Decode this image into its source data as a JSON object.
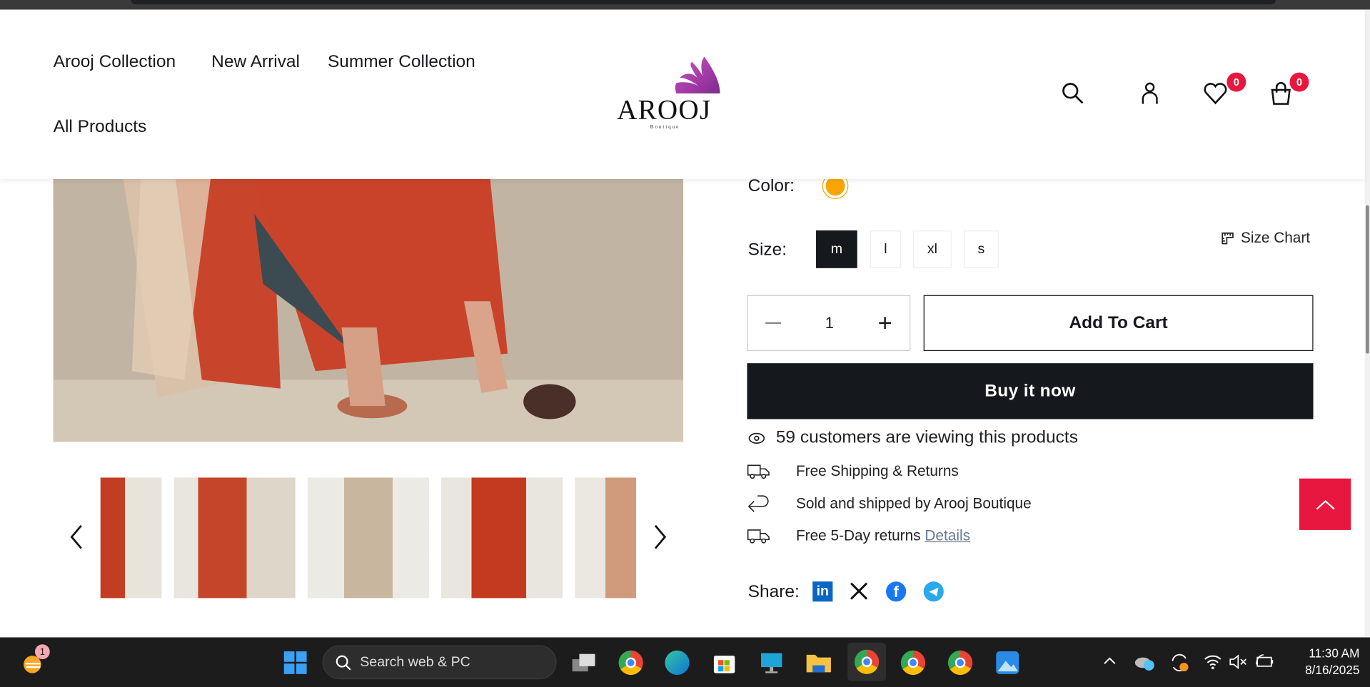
{
  "header": {
    "nav": [
      "Arooj Collection",
      "New Arrival",
      "Summer Collection",
      "All Products"
    ],
    "logo_text": "AROOJ",
    "logo_sub": "Boutique",
    "wishlist_count": "0",
    "cart_count": "0"
  },
  "product": {
    "color_label": "Color:",
    "color_swatch": "#f9a602",
    "size_label": "Size:",
    "sizes": [
      "m",
      "l",
      "xl",
      "s"
    ],
    "selected_size": "m",
    "size_chart": "Size Chart",
    "quantity": "1",
    "add_to_cart": "Add To Cart",
    "buy_now": "Buy it now",
    "viewers": "59 customers are viewing this products",
    "features": [
      "Free Shipping & Returns",
      "Sold and shipped by Arooj Boutique",
      "Free 5-Day returns"
    ],
    "details_link": "Details",
    "share_label": "Share:"
  },
  "taskbar": {
    "search_placeholder": "Search web & PC",
    "widget_badge": "1",
    "time": "11:30 AM",
    "date": "8/16/2025"
  },
  "colors": {
    "accent": "#e8173f",
    "dark": "#15181d"
  }
}
